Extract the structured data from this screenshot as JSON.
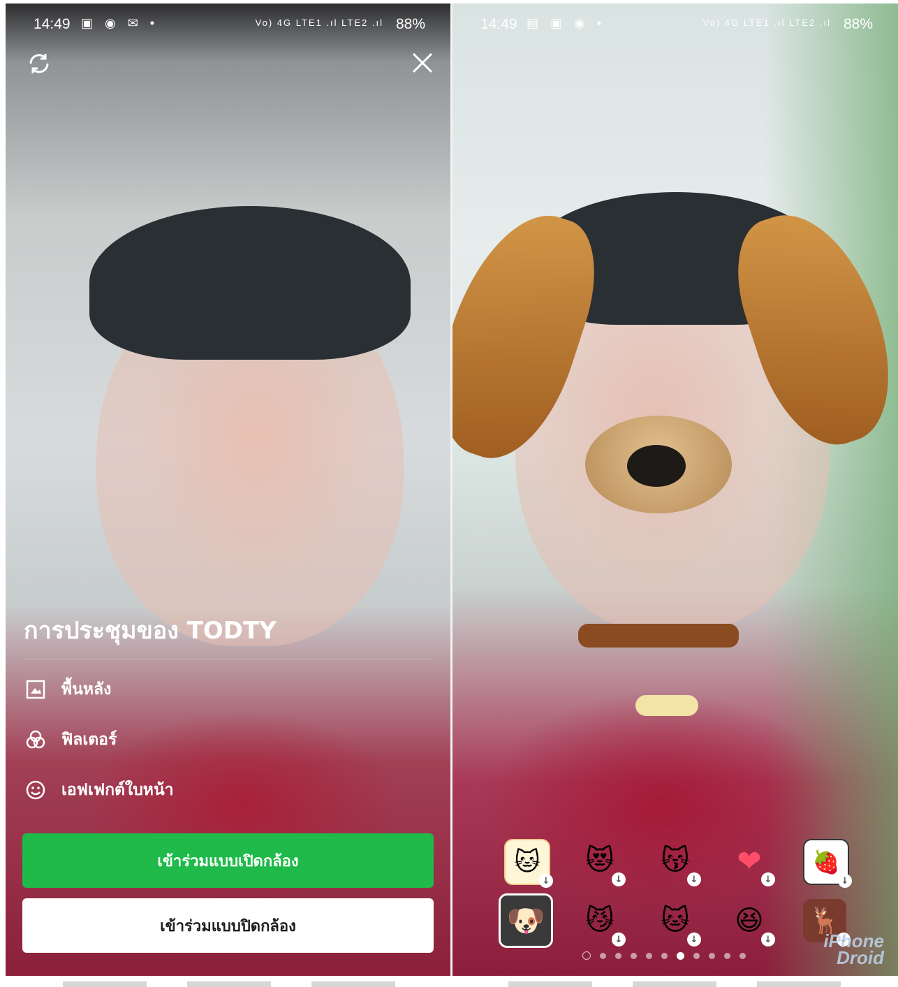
{
  "status_left": {
    "time": "14:49",
    "notification_icons": [
      "image-icon",
      "line-icon",
      "mail-icon",
      "dot-icon"
    ],
    "network": "Vo) 4G LTE1 .ıl LTE2 .ıl",
    "battery": "88%"
  },
  "status_right": {
    "time": "14:49",
    "notification_icons": [
      "gallery-icon",
      "image-icon",
      "line-icon",
      "dot-icon"
    ],
    "network": "Vo) 4G LTE1 .ıl LTE2 .ıl",
    "battery": "88%"
  },
  "left_screen": {
    "meeting_title": "การประชุมของ TODTY",
    "menu": [
      {
        "label": "พื้นหลัง",
        "icon": "background-image-icon"
      },
      {
        "label": "ฟิลเตอร์",
        "icon": "filter-icon"
      },
      {
        "label": "เอฟเฟกต์ใบหน้า",
        "icon": "face-effect-icon"
      }
    ],
    "join_with_camera": "เข้าร่วมแบบเปิดกล้อง",
    "join_without_camera": "เข้าร่วมแบบปิดกล้อง"
  },
  "right_screen": {
    "stickers_row1": [
      "cat-orange-sticker",
      "cat-heart-sticker",
      "gray-cat-sticker",
      "heart-sticker",
      "strawberry-sticker"
    ],
    "stickers_row2": [
      "dog-sticker",
      "red-cat-sticker",
      "white-cat-sticker",
      "laughing-face-sticker",
      "deer-girl-sticker"
    ],
    "selected_sticker": "dog-sticker",
    "page_count": 11,
    "active_page": 7,
    "watermark_line1": "iPhone",
    "watermark_line2": "Droid"
  }
}
